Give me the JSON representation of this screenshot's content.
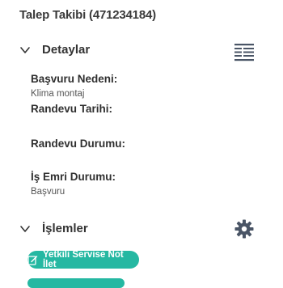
{
  "header": {
    "title": "Talep Takibi (471234184)"
  },
  "details": {
    "heading": "Detaylar",
    "fields": [
      {
        "label": "Başvuru Nedeni:",
        "value": "Klima montaj"
      },
      {
        "label": "Randevu Tarihi:",
        "value": ""
      },
      {
        "label": "Randevu Durumu:",
        "value": ""
      },
      {
        "label": "İş Emri Durumu:",
        "value": "Başvuru"
      }
    ]
  },
  "actions": {
    "heading": "İşlemler",
    "button_label": "Yetkili Servise Not İlet"
  },
  "colors": {
    "accent": "#25b8a2",
    "icon": "#4a5566"
  },
  "icons": {
    "details_toggle": "chevron-down-icon",
    "details_side": "document-list-icon",
    "actions_toggle": "chevron-down-icon",
    "actions_side": "gear-icon",
    "button": "edit-note-icon"
  }
}
